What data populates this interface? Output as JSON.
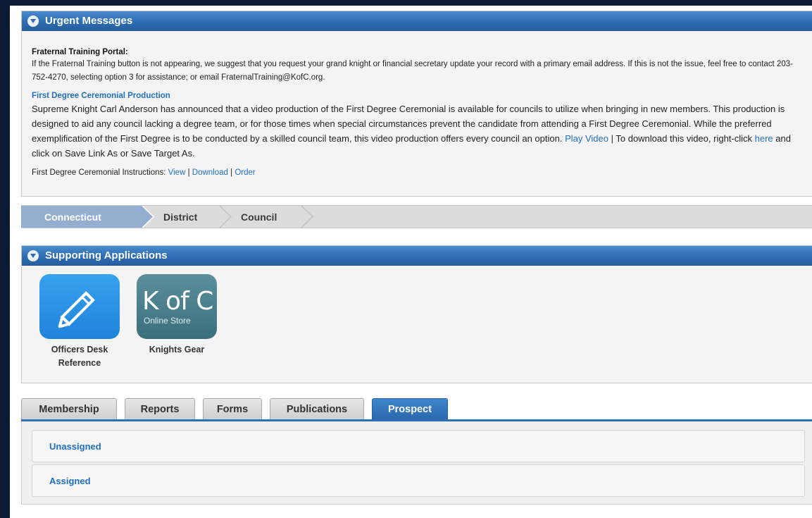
{
  "urgent": {
    "header": "Urgent Messages",
    "portal_title": "Fraternal Training Portal:",
    "portal_text": "If the Fraternal Training button is not appearing, we suggest that you request your grand knight or financial secretary update your record with a primary email address. If this is not the issue, feel free to contact 203-752-4270, selecting option 3 for assistance; or email FraternalTraining@KofC.org.",
    "ceremonial_title": "First Degree Ceremonial Production",
    "ceremonial_text": "Supreme Knight Carl Anderson has announced that a video production of the First Degree Ceremonial is available for councils to utilize when bringing in new members. This production is designed to aid any council lacking a degree team, or for those times when special circumstances prevent the candidate from attending a First Degree Ceremonial. While the preferred exemplification of the First Degree is to be conducted by a skilled council team, this video production offers every council an option.",
    "play_video": "Play Video",
    "download_text_1": " | To download this video, right-click ",
    "here": "here",
    "download_text_2": " and click on Save Link As or Save Target As.",
    "instructions_label": "First Degree Ceremonial Instructions: ",
    "view": "View",
    "sep1": " | ",
    "download": "Download",
    "sep2": " | ",
    "order": "Order"
  },
  "breadcrumb": {
    "items": [
      "Connecticut",
      "District",
      "Council"
    ]
  },
  "apps": {
    "header": "Supporting Applications",
    "items": [
      {
        "label": "Officers Desk Reference",
        "icon": "pencil-icon"
      },
      {
        "label": "Knights Gear",
        "icon": "kofc-store-icon",
        "icon_big": "K of C",
        "icon_small": "Online Store"
      }
    ]
  },
  "tabs": {
    "items": [
      "Membership",
      "Reports",
      "Forms",
      "Publications",
      "Prospect"
    ],
    "active": "Prospect"
  },
  "prospect": {
    "items": [
      "Unassigned",
      "Assigned"
    ]
  },
  "colors": {
    "header_blue": "#2d6db3",
    "link_blue": "#1f6fc1",
    "breadcrumb_active": "#94aed0",
    "background_navy": "#0b1a33"
  }
}
